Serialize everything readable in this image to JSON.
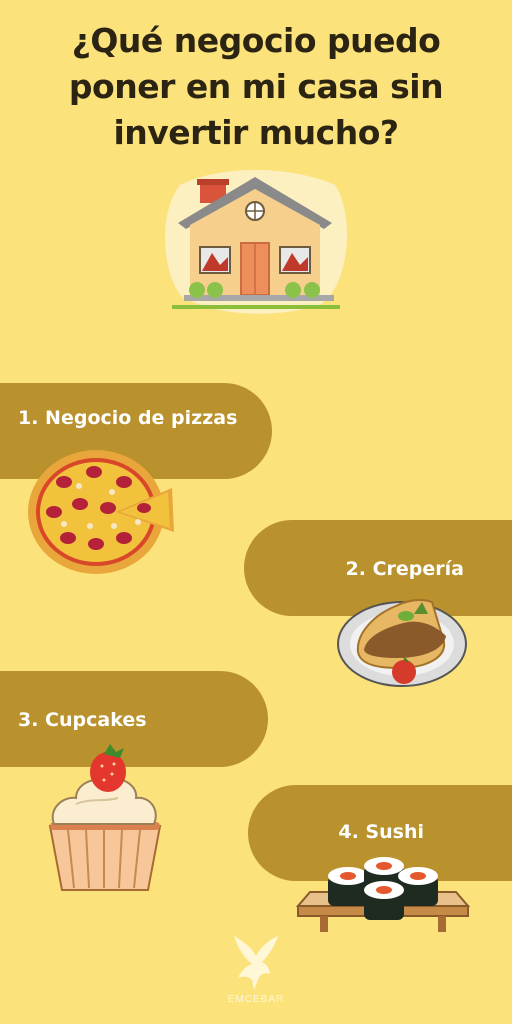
{
  "title": {
    "line1": "¿Qué negocio puedo",
    "line2": "poner en mi casa sin",
    "line3": "invertir mucho?"
  },
  "items": [
    {
      "label": "1. Negocio de pizzas",
      "icon": "pizza-icon"
    },
    {
      "label": "2. Crepería",
      "icon": "crepe-icon"
    },
    {
      "label": "3. Cupcakes",
      "icon": "cupcake-icon"
    },
    {
      "label": "4. Sushi",
      "icon": "sushi-icon"
    }
  ],
  "brand": {
    "name": "EMCEBAR",
    "logo_icon": "eagle-icon"
  },
  "colors": {
    "background": "#fbe27a",
    "pill": "#b9912d",
    "title_text": "#2b2412",
    "label_text": "#ffffff"
  }
}
